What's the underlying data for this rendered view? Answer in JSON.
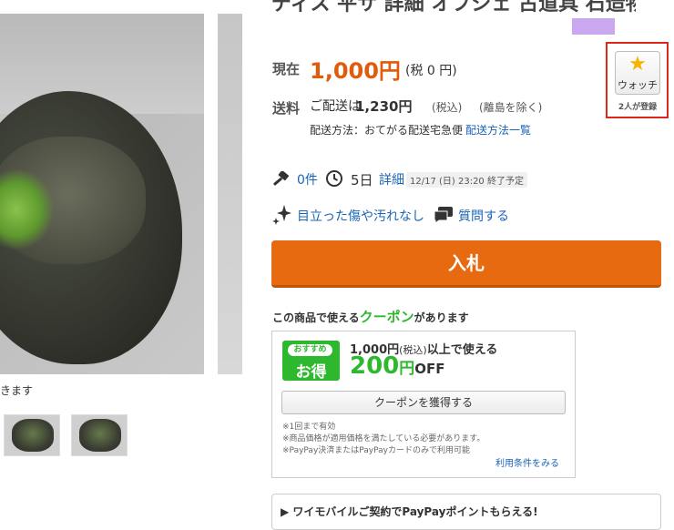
{
  "gallery": {
    "caption": "きます"
  },
  "item": {
    "title_fragment": "ディス 平サ 詳細 オブジェ 古道具 石造物"
  },
  "price": {
    "label": "現在",
    "value": "1,000円",
    "tax": "(税 0 円)"
  },
  "shipping": {
    "label": "送料",
    "prefix": "ご配送は",
    "amount": "1,230円",
    "tax_note": "(税込)",
    "region_note": "(離島を除く)",
    "method_label": "配送方法：おてがる配送宅急便",
    "method_link": "配送方法一覧"
  },
  "watch": {
    "star": "★",
    "label": "ウォッチ",
    "count": "2人が登録"
  },
  "stats": {
    "bids": "0件",
    "days": "5日",
    "detail_link": "詳細",
    "end_time": "12/17 (日) 23:20 終了予定",
    "condition": "目立った傷や汚れなし",
    "question": "質問する"
  },
  "bid_button": "入札",
  "coupon": {
    "head_before": "この商品で使える",
    "head_highlight": "クーポン",
    "head_after": "があります",
    "badge_top": "おすすめ",
    "badge_main": "お得",
    "condition_amount": "1,000円",
    "condition_tax": "(税込)",
    "condition_tail": "以上で使える",
    "discount": "200",
    "discount_unit": "円",
    "discount_off": "OFF",
    "get_button": "クーポンを獲得する",
    "notes": [
      "※1回まで有効",
      "※商品価格が適用価格を満たしている必要があります。",
      "※PayPay決済またはPayPayカードのみで利用可能"
    ],
    "terms_link": "利用条件をみる"
  },
  "promo": {
    "text": "ワイモバイルご契約でPayPayポイントもらえる!"
  },
  "colors": {
    "price": "#e05c0a",
    "bid_button": "#e86a10",
    "coupon_green": "#2eb82e",
    "link": "#1a64b8",
    "watch_highlight": "#e0261c"
  }
}
